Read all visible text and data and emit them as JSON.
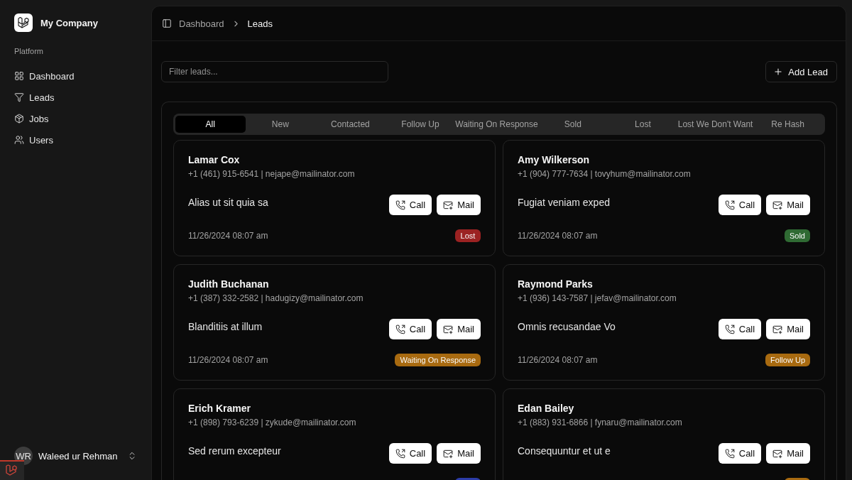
{
  "sidebar": {
    "company": "My Company",
    "section_label": "Platform",
    "items": [
      {
        "label": "Dashboard",
        "kind": "grid"
      },
      {
        "label": "Leads",
        "kind": "funnel"
      },
      {
        "label": "Jobs",
        "kind": "package"
      },
      {
        "label": "Users",
        "kind": "users"
      }
    ],
    "user": {
      "initials": "WR",
      "name": "Waleed ur Rehman"
    }
  },
  "breadcrumb": [
    "Dashboard",
    "Leads"
  ],
  "filter": {
    "placeholder": "Filter leads..."
  },
  "add_button": {
    "label": "Add Lead"
  },
  "tabs": [
    {
      "label": "All",
      "selected": true
    },
    {
      "label": "New",
      "selected": false
    },
    {
      "label": "Contacted",
      "selected": false
    },
    {
      "label": "Follow Up",
      "selected": false
    },
    {
      "label": "Waiting On Response",
      "selected": false
    },
    {
      "label": "Sold",
      "selected": false
    },
    {
      "label": "Lost",
      "selected": false
    },
    {
      "label": "Lost We Don't Want",
      "selected": false
    },
    {
      "label": "Re Hash",
      "selected": false
    }
  ],
  "leads": [
    {
      "name": "Lamar Cox",
      "contact": "+1 (461) 915-6541 | nejape@mailinator.com",
      "note": "Alias ut sit quia sa",
      "call_label": "Call",
      "mail_label": "Mail",
      "date": "11/26/2024 08:07 am",
      "status": {
        "label": "Lost",
        "color": "#9b2222"
      }
    },
    {
      "name": "Amy Wilkerson",
      "contact": "+1 (904) 777-7634 | tovyhum@mailinator.com",
      "note": "Fugiat veniam exped",
      "call_label": "Call",
      "mail_label": "Mail",
      "date": "11/26/2024 08:07 am",
      "status": {
        "label": "Sold",
        "color": "#2f6a33"
      }
    },
    {
      "name": "Judith Buchanan",
      "contact": "+1 (387) 332-2582 | hadugizy@mailinator.com",
      "note": "Blanditiis at illum",
      "call_label": "Call",
      "mail_label": "Mail",
      "date": "11/26/2024 08:07 am",
      "status": {
        "label": "Waiting On Response",
        "color": "#a86a10"
      }
    },
    {
      "name": "Raymond Parks",
      "contact": "+1 (936) 143-7587 | jefav@mailinator.com",
      "note": "Omnis recusandae Vo",
      "call_label": "Call",
      "mail_label": "Mail",
      "date": "11/26/2024 08:07 am",
      "status": {
        "label": "Follow Up",
        "color": "#a86a10"
      }
    },
    {
      "name": "Erich Kramer",
      "contact": "+1 (898) 793-6239 | zykude@mailinator.com",
      "note": "Sed rerum excepteur",
      "call_label": "Call",
      "mail_label": "Mail",
      "status": {
        "color": "#2c3ca8"
      }
    },
    {
      "name": "Edan Bailey",
      "contact": "+1 (883) 931-6866 | fynaru@mailinator.com",
      "note": "Consequuntur et ut e",
      "call_label": "Call",
      "mail_label": "Mail",
      "status": {
        "color": "#a86a10"
      }
    }
  ]
}
